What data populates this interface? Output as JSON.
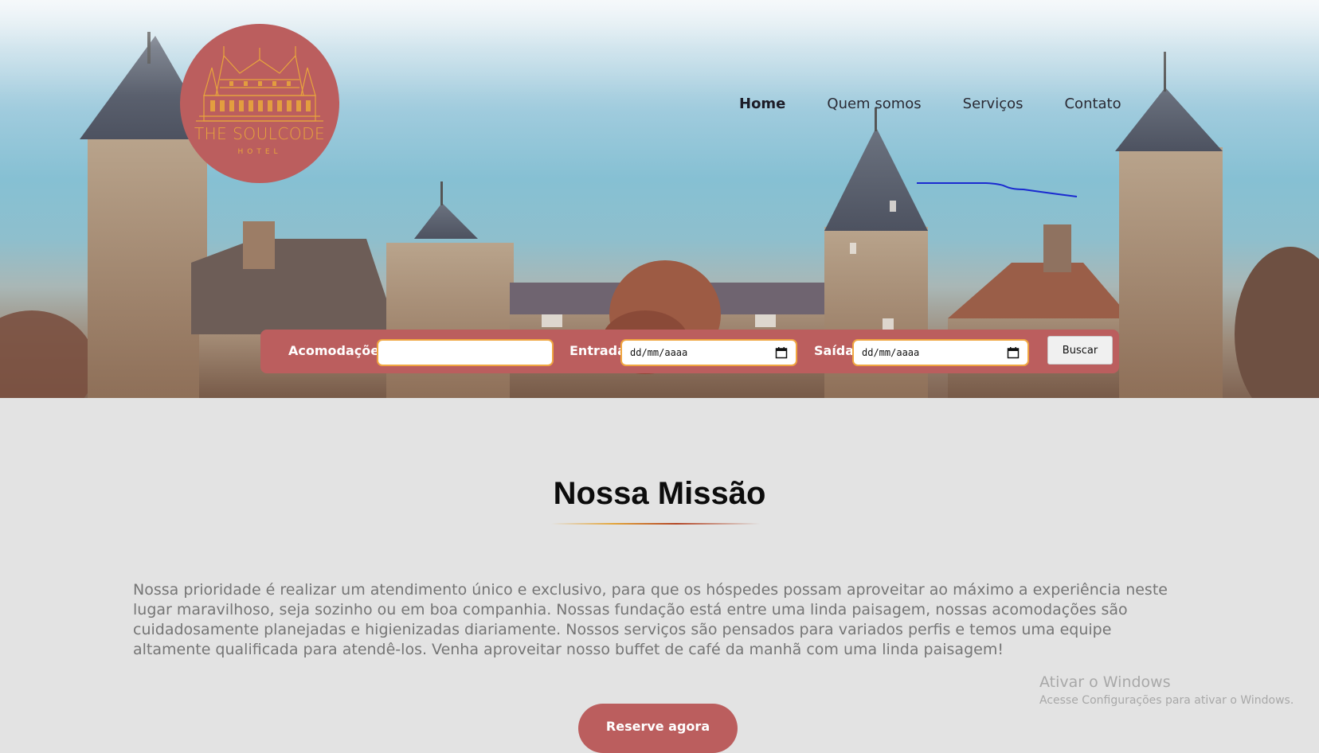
{
  "brand": {
    "name": "THE SOULCODE",
    "sub": "HOTEL",
    "color": "#bb5e5e",
    "logo_line_color": "#e8a53c"
  },
  "nav": {
    "items": [
      "Home",
      "Quem somos",
      "Serviços",
      "Contato"
    ],
    "active": "Home"
  },
  "search": {
    "accommodations_label": "Acomodações",
    "accommodations_value": "",
    "checkin_label": "Entrada",
    "checkin_placeholder": "dd/mm/aaaa",
    "checkout_label": "Saída",
    "checkout_placeholder": "dd/mm/aaaa",
    "submit_label": "Buscar",
    "calendar_icon": "calendar-icon"
  },
  "mission": {
    "title": "Nossa Missão",
    "text": "Nossa prioridade é realizar um atendimento único e exclusivo, para que os hóspedes possam aproveitar ao máximo a experiência neste lugar maravilhoso, seja sozinho ou em boa companhia. Nossas fundação está entre uma linda paisagem, nossas acomodações são cuidadosamente planejadas e higienizadas diariamente. Nossos serviços são pensados para variados perfis e temos uma equipe altamente qualificada para atendê-los. Venha aproveitar nosso buffet de café da manhã com uma linda paisagem!",
    "cta": "Reserve agora"
  },
  "watermark": {
    "title": "Ativar o Windows",
    "subtitle": "Acesse Configurações para ativar o Windows."
  },
  "colors": {
    "accent": "#bb5e5e",
    "input_border": "#f0a640",
    "page_bg": "#e3e3e3",
    "text_muted": "#757575"
  }
}
